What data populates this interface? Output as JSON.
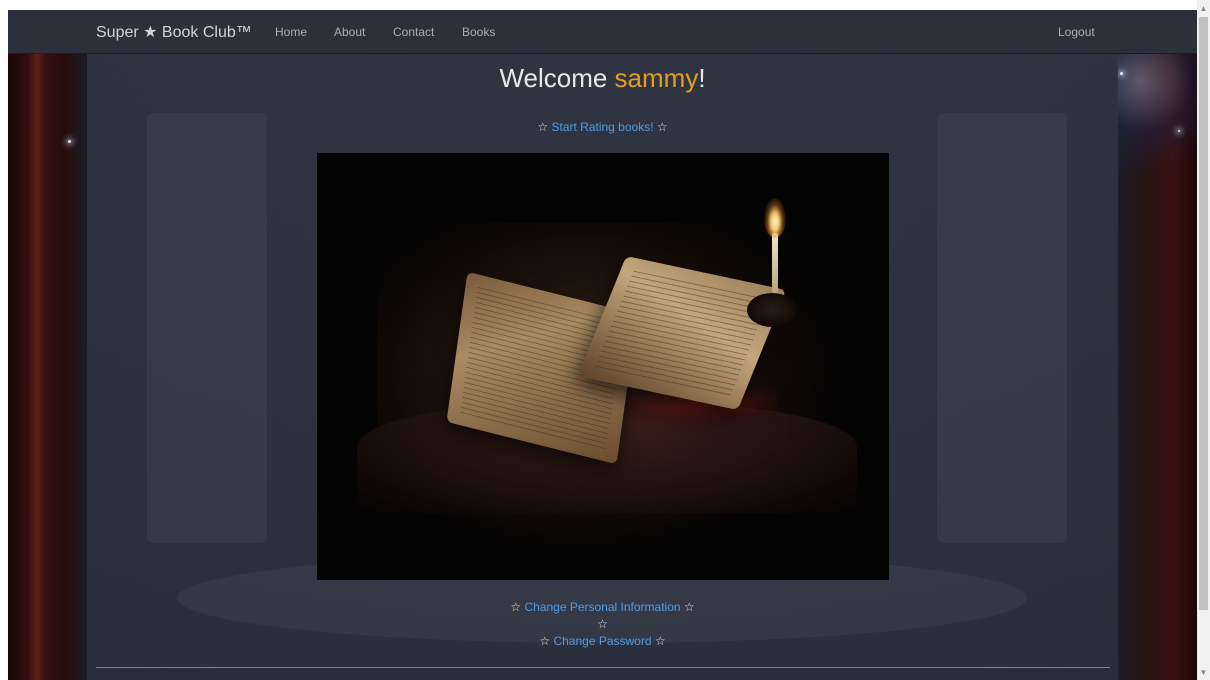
{
  "navbar": {
    "brand": "Super ★ Book Club™",
    "links": [
      "Home",
      "About",
      "Contact",
      "Books"
    ],
    "logout": "Logout"
  },
  "welcome": {
    "prefix": "Welcome ",
    "username": "sammy",
    "suffix": "!"
  },
  "actions": {
    "star": "☆",
    "start_rating": "Start Rating books!",
    "change_info": "Change Personal Information",
    "change_password": "Change Password"
  },
  "hero": {
    "icon": "open-book-with-candle-image"
  },
  "scrollbar": {
    "up": "▲",
    "down": "▼"
  },
  "colors": {
    "navbar_bg": "#2b303b",
    "username": "#e0a01c",
    "link": "#4d9be6",
    "text": "#e8e8ea"
  }
}
